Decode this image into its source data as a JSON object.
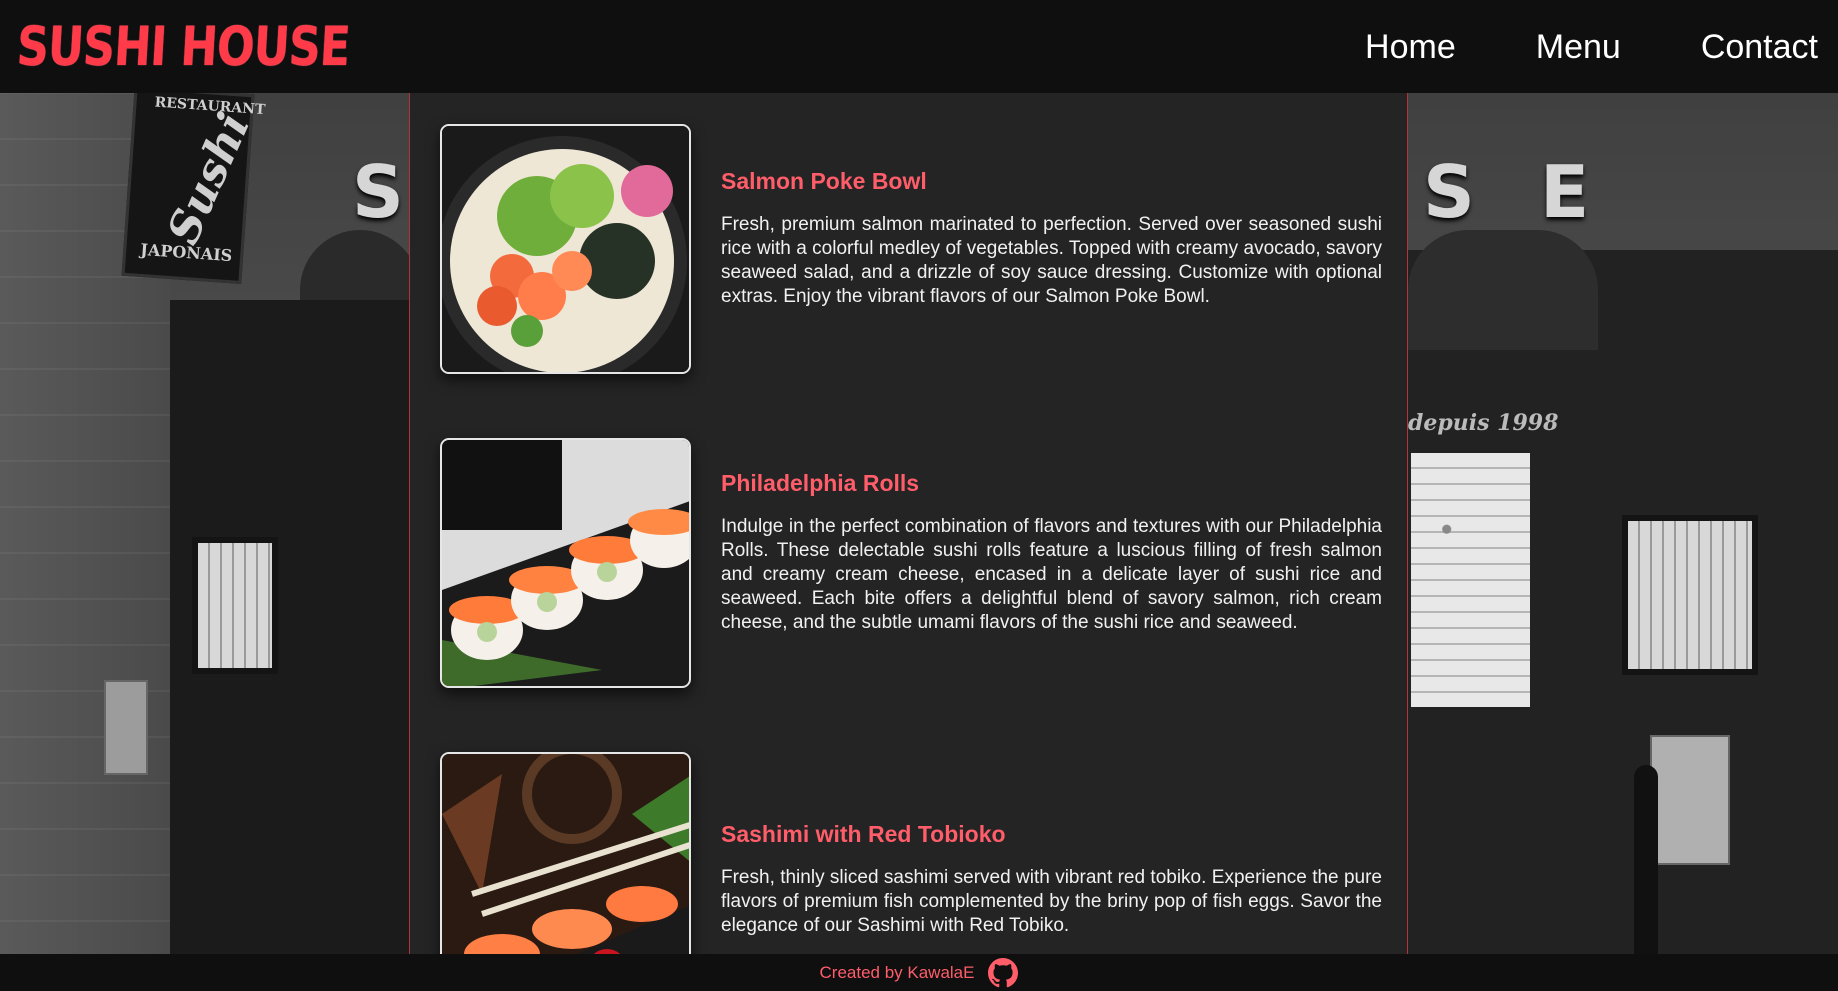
{
  "header": {
    "logo": "SUSHI HOUSE",
    "nav": [
      {
        "label": "Home"
      },
      {
        "label": "Menu"
      },
      {
        "label": "Contact"
      }
    ]
  },
  "background": {
    "sign_letters": [
      "S",
      "S",
      "E"
    ],
    "hanging_sign_lines": [
      "RESTAURANT",
      "Sushi",
      "JAPONAIS"
    ],
    "window_script": "depuis 1998"
  },
  "menu": {
    "items": [
      {
        "title": "Salmon Poke Bowl",
        "description": "Fresh, premium salmon marinated to perfection. Served over seasoned sushi rice with a colorful medley of vegetables. Topped with creamy avocado, savory seaweed salad, and a drizzle of soy sauce dressing. Customize with optional extras. Enjoy the vibrant flavors of our Salmon Poke Bowl.",
        "image": "salmon-poke-bowl-photo"
      },
      {
        "title": "Philadelphia Rolls",
        "description": "Indulge in the perfect combination of flavors and textures with our Philadelphia Rolls. These delectable sushi rolls feature a luscious filling of fresh salmon and creamy cream cheese, encased in a delicate layer of sushi rice and seaweed. Each bite offers a delightful blend of savory salmon, rich cream cheese, and the subtle umami flavors of the sushi rice and seaweed.",
        "image": "philadelphia-rolls-photo"
      },
      {
        "title": "Sashimi with Red Tobioko",
        "description": "Fresh, thinly sliced sashimi served with vibrant red tobiko. Experience the pure flavors of premium fish complemented by the briny pop of fish eggs. Savor the elegance of our Sashimi with Red Tobiko.",
        "image": "sashimi-red-tobiko-photo"
      }
    ]
  },
  "footer": {
    "credit": "Created by KawalaE",
    "icon": "github-icon"
  },
  "colors": {
    "accent": "#ff5d6a",
    "logo": "#ff3b4a",
    "header_bg": "#0f0f0f",
    "panel_bg": "#242424"
  }
}
